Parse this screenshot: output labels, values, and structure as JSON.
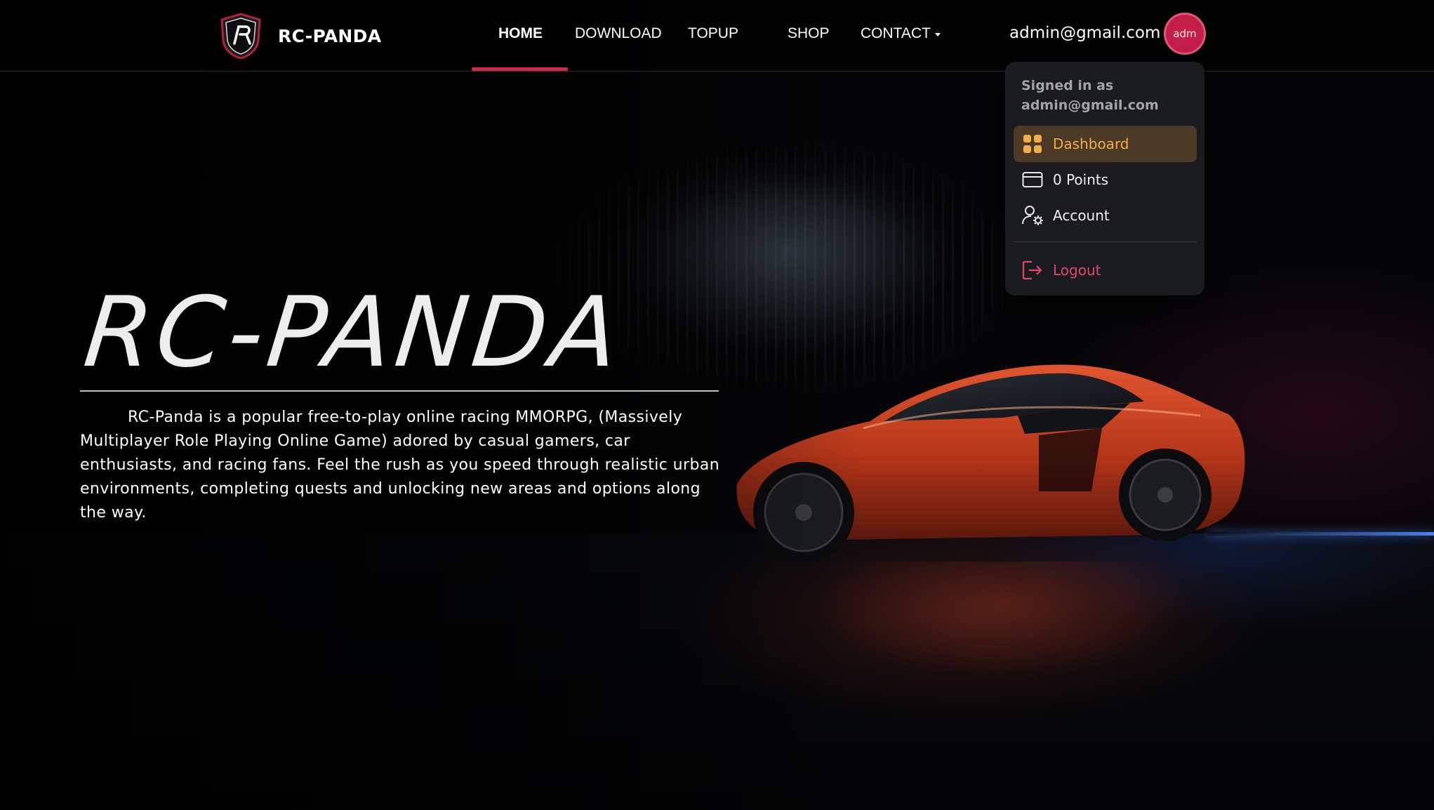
{
  "brand": {
    "name": "RC-PANDA",
    "logo_icon": "shield-r-logo"
  },
  "nav": {
    "items": [
      {
        "label": "HOME",
        "active": true
      },
      {
        "label": "DOWNLOAD",
        "active": false
      },
      {
        "label": "TOPUP",
        "active": false
      },
      {
        "label": "SHOP",
        "active": false
      },
      {
        "label": "CONTACT",
        "active": false,
        "has_dropdown": true
      }
    ]
  },
  "user": {
    "email": "admin@gmail.com",
    "avatar_text": "adm"
  },
  "dropdown": {
    "signed_in_label": "Signed in as",
    "signed_in_email": "admin@gmail.com",
    "items": [
      {
        "label": "Dashboard",
        "icon": "dashboard-grid-icon",
        "highlighted": true
      },
      {
        "label": "0 Points",
        "icon": "card-icon"
      },
      {
        "label": "Account",
        "icon": "user-gear-icon"
      },
      {
        "label": "Logout",
        "icon": "logout-icon"
      }
    ]
  },
  "hero": {
    "title": "RC-PANDA",
    "description": "RC-Panda is a popular free-to-play online racing MMORPG, (Massively Multiplayer Role Playing Online Game) adored by casual gamers, car enthusiasts, and racing fans. Feel the rush as you speed through realistic urban environments, completing quests and unlocking new areas and options along the way."
  },
  "colors": {
    "accent": "#d4264e",
    "avatar_bg": "#c41e4b",
    "dashboard_highlight_bg": "#4b3a26",
    "dashboard_highlight_text": "#f2ad4b",
    "logout": "#e3476d",
    "dropdown_bg": "#1a1b1f"
  }
}
